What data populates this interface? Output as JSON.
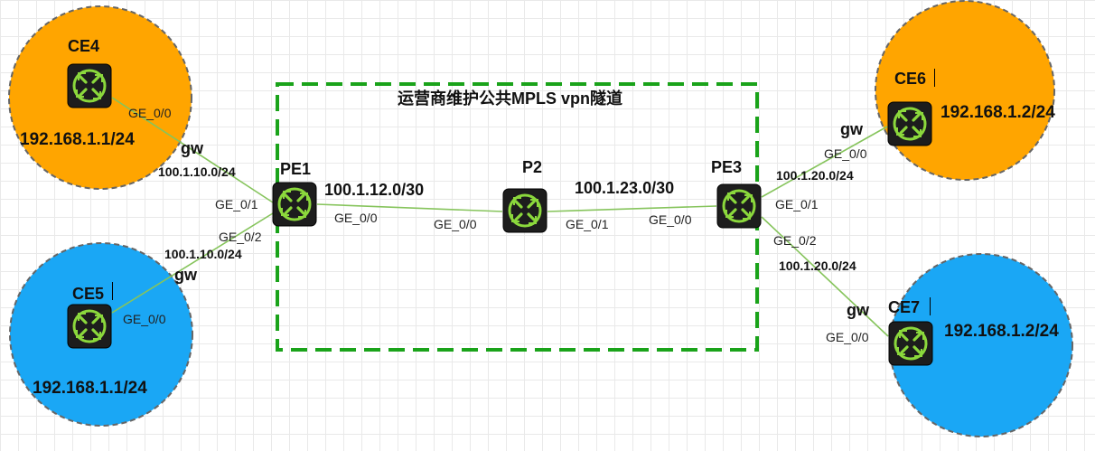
{
  "tunnel_label": "运营商维护公共MPLS vpn隧道",
  "nodes": {
    "ce4": "CE4",
    "ce5": "CE5",
    "ce6": "CE6",
    "ce7": "CE7",
    "pe1": "PE1",
    "p2": "P2",
    "pe3": "PE3"
  },
  "hosts": {
    "ce4": "192.168.1.1/24",
    "ce5": "192.168.1.1/24",
    "ce6": "192.168.1.2/24",
    "ce7": "192.168.1.2/24"
  },
  "networks": {
    "pe1_p2": "100.1.12.0/30",
    "p2_pe3": "100.1.23.0/30",
    "ce4_pe1": "100.1.10.0/24",
    "ce5_pe1": "100.1.10.0/24",
    "pe3_ce6": "100.1.20.0/24",
    "pe3_ce7": "100.1.20.0/24"
  },
  "gateway_label": "gw",
  "ports": {
    "ce4": "GE_0/0",
    "ce5": "GE_0/0",
    "ce6": "GE_0/0",
    "ce7": "GE_0/0",
    "pe1_ce4": "GE_0/1",
    "pe1_ce5": "GE_0/2",
    "pe1_p2": "GE_0/0",
    "p2_pe1": "GE_0/0",
    "p2_pe3": "GE_0/1",
    "pe3_p2": "GE_0/0",
    "pe3_ce6": "GE_0/1",
    "pe3_ce7": "GE_0/2"
  },
  "colors": {
    "site_a": "#ffa500",
    "site_b": "#1aa7f5",
    "tunnel_border": "#1aa31a",
    "link": "#86c45c",
    "router_body": "#1d1d1d",
    "router_icon": "#8bd83c"
  },
  "icons": [
    "router-icon"
  ]
}
